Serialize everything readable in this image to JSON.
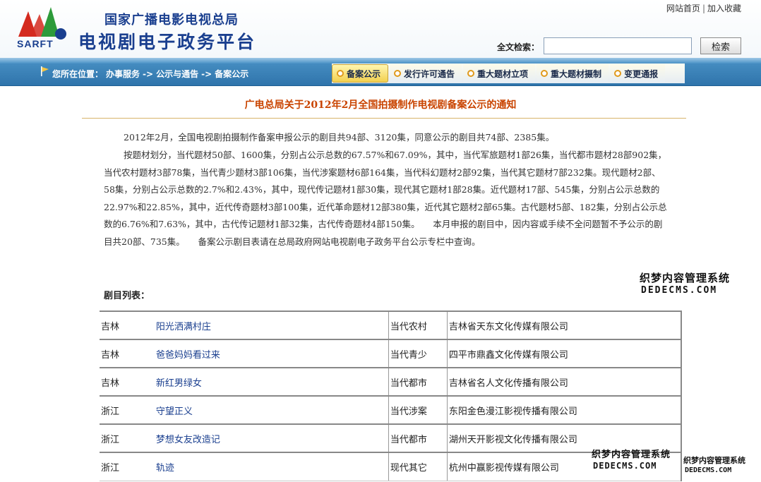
{
  "header": {
    "org_name": "国家广播电影电视总局",
    "platform_name": "电视剧电子政务平台",
    "logo_text": "SARFT",
    "top_links": {
      "home": "网站首页",
      "favorite": "加入收藏",
      "separator": "|"
    },
    "search": {
      "label": "全文检索：",
      "value": "",
      "placeholder": "",
      "button": "检索"
    }
  },
  "nav": {
    "location_label": "您所在位置：",
    "breadcrumb": [
      "办事服务",
      "->",
      "公示与通告",
      "->",
      "备案公示"
    ],
    "tabs": [
      {
        "label": "备案公示",
        "active": true
      },
      {
        "label": "发行许可通告",
        "active": false
      },
      {
        "label": "重大题材立项",
        "active": false
      },
      {
        "label": "重大题材摄制",
        "active": false
      },
      {
        "label": "变更通报",
        "active": false
      }
    ]
  },
  "article": {
    "title": "广电总局关于2012年2月全国拍摄制作电视剧备案公示的通知",
    "paragraph1": "2012年2月，全国电视剧拍摄制作备案申报公示的剧目共94部、3120集，同意公示的剧目共74部、2385集。",
    "paragraph2": "按题材划分，当代题材50部、1600集，分别占公示总数的67.57%和67.09%，其中，当代军旅题材1部26集，当代都市题材28部902集，当代农村题材3部78集，当代青少题材3部106集，当代涉案题材6部164集，当代科幻题材2部92集，当代其它题材7部232集。现代题材2部、58集，分别占公示总数的2.7%和2.43%，其中，现代传记题材1部30集，现代其它题材1部28集。近代题材17部、545集，分别占公示总数的22.97%和22.85%，其中，近代传奇题材3部100集，近代革命题材12部380集，近代其它题材2部65集。古代题材5部、182集，分别占公示总数的6.76%和7.63%，其中，古代传记题材1部32集，古代传奇题材4部150集。　　本月申报的剧目中，因内容或手续不全问题暂不予公示的剧目共20部、735集。　　备案公示剧目表请在总局政府网站电视剧电子政务平台公示专栏中查询。",
    "list_title": "剧目列表："
  },
  "table": {
    "rows": [
      {
        "province": "吉林",
        "title": "阳光洒满村庄",
        "genre": "当代农村",
        "company": "吉林省天东文化传媒有限公司"
      },
      {
        "province": "吉林",
        "title": "爸爸妈妈看过来",
        "genre": "当代青少",
        "company": "四平市鼎鑫文化传媒有限公司"
      },
      {
        "province": "吉林",
        "title": "新红男绿女",
        "genre": "当代都市",
        "company": "吉林省名人文化传播有限公司"
      },
      {
        "province": "浙江",
        "title": "守望正义",
        "genre": "当代涉案",
        "company": "东阳金色漫江影视传播有限公司"
      },
      {
        "province": "浙江",
        "title": "梦想女友改造记",
        "genre": "当代都市",
        "company": "湖州天开影视文化传播有限公司"
      },
      {
        "province": "浙江",
        "title": "轨迹",
        "genre": "现代其它",
        "company": "杭州中赢影视传媒有限公司"
      }
    ]
  },
  "watermarks": {
    "cn": "织梦内容管理系统",
    "en": "DEDECMS.COM"
  }
}
